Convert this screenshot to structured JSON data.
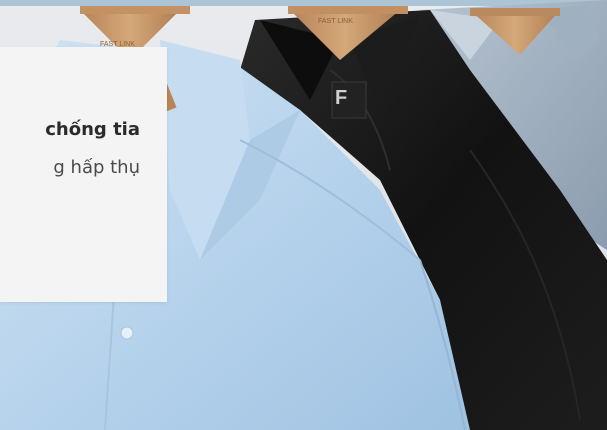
{
  "card": {
    "heading_fragment": "chống tia",
    "body_fragment": "g hấp thụ"
  },
  "brand": {
    "hanger_logo_text": "FAST LINK",
    "label_fragment": "F"
  },
  "colors": {
    "light_blue_shirt": "#bcd7ee",
    "black_shirt": "#151515",
    "grey_blue_shirt": "#a8b7c7",
    "wood_hanger": "#c89a6c",
    "card_bg": "#f4f4f4",
    "heading_text": "#2b2b2b",
    "body_text": "#4a4a4a"
  }
}
